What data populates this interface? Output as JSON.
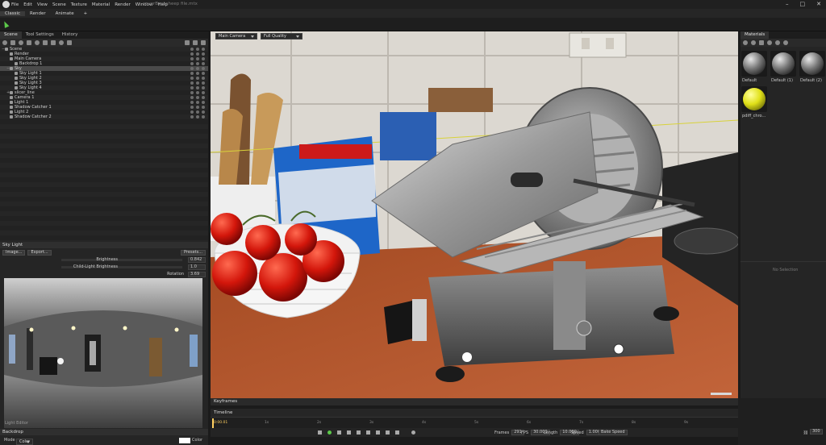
{
  "app": {
    "menu": [
      "File",
      "Edit",
      "View",
      "Scene",
      "Texture",
      "Material",
      "Render",
      "Window",
      "Help"
    ],
    "doc_title": "coverBacksheep file.mtx"
  },
  "modes": [
    "Classic",
    "Render",
    "Animate",
    "+"
  ],
  "scene_panel": {
    "tabs": [
      "Scene",
      "Tool Settings",
      "History"
    ],
    "tree": [
      {
        "label": "Scene",
        "indent": 0,
        "expand": "−"
      },
      {
        "label": "Render",
        "indent": 1,
        "expand": ""
      },
      {
        "label": "Main Camera",
        "indent": 1,
        "expand": ""
      },
      {
        "label": "Backdrop 1",
        "indent": 2,
        "expand": ""
      },
      {
        "label": "Sky",
        "indent": 1,
        "expand": "−",
        "selected": true
      },
      {
        "label": "Sky Light 1",
        "indent": 2,
        "expand": ""
      },
      {
        "label": "Sky Light 2",
        "indent": 2,
        "expand": ""
      },
      {
        "label": "Sky Light 3",
        "indent": 2,
        "expand": ""
      },
      {
        "label": "Sky Light 4",
        "indent": 2,
        "expand": ""
      },
      {
        "label": "slicer_line",
        "indent": 1,
        "expand": "+"
      },
      {
        "label": "Camera 1",
        "indent": 1,
        "expand": ""
      },
      {
        "label": "Light 1",
        "indent": 1,
        "expand": ""
      },
      {
        "label": "Shadow Catcher 1",
        "indent": 1,
        "expand": ""
      },
      {
        "label": "Light 2",
        "indent": 1,
        "expand": ""
      },
      {
        "label": "Shadow Catcher 2",
        "indent": 1,
        "expand": ""
      }
    ]
  },
  "sky_light": {
    "header": "Sky Light",
    "buttons": {
      "image": "Image...",
      "export": "Export...",
      "presets": "Presets..."
    },
    "brightness": {
      "label": "Brightness",
      "value": "0.842"
    },
    "child_brightness": {
      "label": "Child-Light Brightness",
      "value": "1.0"
    },
    "rotation": {
      "label": "Rotation",
      "value": "3.69"
    },
    "editor_label": "Light Editor"
  },
  "backdrop": {
    "header": "Backdrop",
    "mode_label": "Mode",
    "mode_value": "Color",
    "color_label": "Color"
  },
  "viewport": {
    "camera": "Main Camera",
    "quality": "Full Quality"
  },
  "materials": {
    "header": "Materials",
    "items": [
      {
        "label": "Default",
        "type": "chrome"
      },
      {
        "label": "Default (1)",
        "type": "chrome"
      },
      {
        "label": "Default (2)",
        "type": "chrome"
      },
      {
        "label": "pdiff_chro...",
        "type": "yellow"
      }
    ],
    "no_selection": "No Selection"
  },
  "timeline": {
    "keyframes_tab": "Keyframes",
    "timeline_tab": "Timeline",
    "time": "0:00.01",
    "ticks": [
      "1s",
      "2s",
      "3s",
      "4s",
      "5s",
      "6s",
      "7s",
      "8s",
      "9s"
    ],
    "frames_label": "Frames",
    "frames": "291",
    "fps_label": "FPS",
    "fps": "30.000",
    "length_label": "Length",
    "length": "10.000",
    "speed_label": "Speed",
    "speed": "1.000",
    "bake_speed": "Bake Speed",
    "end_frame": "300"
  },
  "colors": {
    "accent_green": "#5cc84a",
    "bg": "#1b1b1b",
    "panel": "#252525"
  }
}
